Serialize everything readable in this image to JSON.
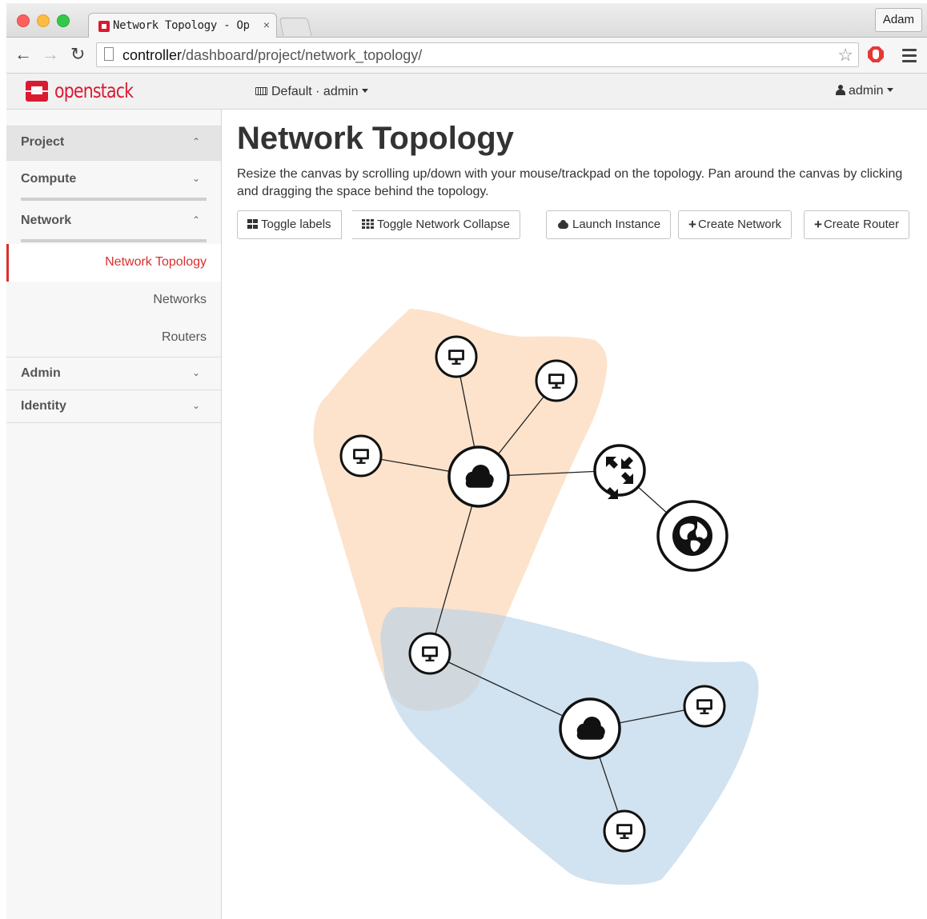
{
  "browser": {
    "tab_title": "Network Topology - OpenS",
    "tab_close": "×",
    "profile": "Adam",
    "url_host": "controller",
    "url_path": "/dashboard/project/network_topology/"
  },
  "header": {
    "logo": "openstack",
    "project_picker": "Default · admin",
    "user": "admin"
  },
  "sidebar": {
    "project": "Project",
    "compute": "Compute",
    "network": "Network",
    "items": [
      "Network Topology",
      "Networks",
      "Routers"
    ],
    "admin": "Admin",
    "identity": "Identity"
  },
  "main": {
    "title": "Network Topology",
    "description": "Resize the canvas by scrolling up/down with your mouse/trackpad on the topology. Pan around the canvas by clicking and dragging the space behind the topology.",
    "buttons": {
      "toggle_labels": "Toggle labels",
      "toggle_collapse": "Toggle Network Collapse",
      "launch_instance": "Launch Instance",
      "create_network": "Create Network",
      "create_router": "Create Router"
    }
  },
  "colors": {
    "accent": "#d9302c",
    "network_a": "#fde3cc",
    "network_b": "#cfe1ee"
  }
}
